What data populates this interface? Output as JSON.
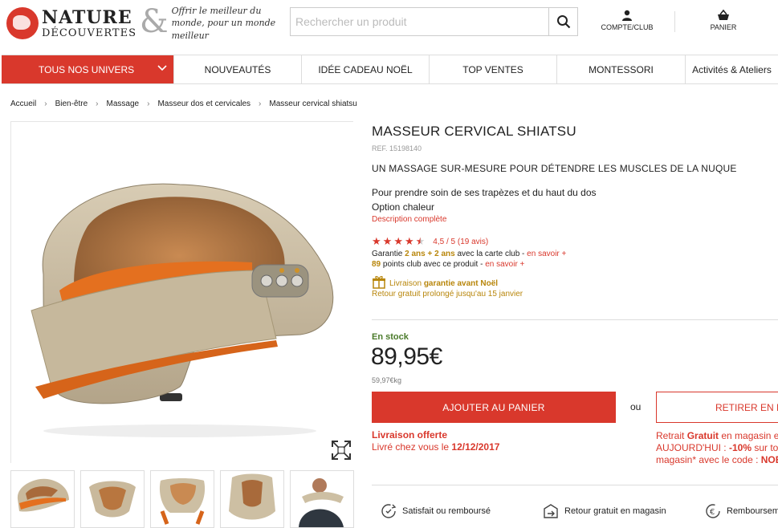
{
  "header": {
    "logo_line1": "NATURE",
    "logo_line2": "DÉCOUVERTES",
    "logo_amp": "&",
    "tagline": "Offrir le meilleur du monde, pour un monde meilleur",
    "search_placeholder": "Rechercher un produit",
    "account_label": "COMPTE/CLUB",
    "cart_label": "PANIER"
  },
  "nav": {
    "items": [
      {
        "label": "TOUS NOS UNIVERS"
      },
      {
        "label": "NOUVEAUTÉS"
      },
      {
        "label": "IDÉE CADEAU NOËL"
      },
      {
        "label": "TOP VENTES"
      },
      {
        "label": "MONTESSORI"
      },
      {
        "label": "Activités & Ateliers"
      }
    ]
  },
  "breadcrumb": [
    "Accueil",
    "Bien-être",
    "Massage",
    "Masseur dos et cervicales",
    "Masseur cervical shiatsu"
  ],
  "product": {
    "title": "MASSEUR CERVICAL SHIATSU",
    "ref": "REF. 15198140",
    "subtitle": "UN MASSAGE SUR-MESURE POUR DÉTENDRE LES MUSCLES DE LA NUQUE",
    "desc_line1": "Pour prendre soin de ses trapèzes et du haut du dos",
    "desc_line2": "Option chaleur",
    "more_link": "Description complète",
    "rating": 4.5,
    "rating_text": "4,5 / 5 (19 avis)",
    "guarantee_prefix": "Garantie ",
    "guarantee_bold": "2 ans + 2 ans",
    "guarantee_suffix": " avec la carte club - ",
    "learn_more": "en savoir +",
    "points_bold": "89",
    "points_suffix": " points club avec ce produit - ",
    "delivery_prefix": "Livraison ",
    "delivery_bold": "garantie avant Noël",
    "return_text": "Retour gratuit prolongé jusqu'au 15 janvier",
    "stock": "En stock",
    "price": "89,95€",
    "unit_price": "59,97€kg",
    "add_to_cart": "AJOUTER AU PANIER",
    "or": "ou",
    "pickup_button": "RETIRER EN MAGASIN",
    "shipping_title": "Livraison offerte",
    "shipping_prefix": "Livré chez vous le ",
    "shipping_date": "12/12/2017",
    "pickup_line1_prefix": "Retrait ",
    "pickup_line1_bold": "Gratuit",
    "pickup_line1_suffix": " en magasin en",
    "pickup_line2_prefix": "AUJOURD'HUI : ",
    "pickup_line2_bold": "-10%",
    "pickup_line2_suffix": " sur tous",
    "pickup_line3_prefix": "magasin* avec le code : ",
    "pickup_line3_bold": "NOEL"
  },
  "reassurance": [
    {
      "label": "Satisfait ou remboursé",
      "icon": "refresh-badge-icon"
    },
    {
      "label": "Retour gratuit en magasin",
      "icon": "store-return-icon"
    },
    {
      "label": "Remboursement",
      "icon": "euro-return-icon"
    }
  ],
  "colors": {
    "brand_red": "#d9382c",
    "gold": "#b8860b",
    "stock_green": "#4a7a2a"
  }
}
